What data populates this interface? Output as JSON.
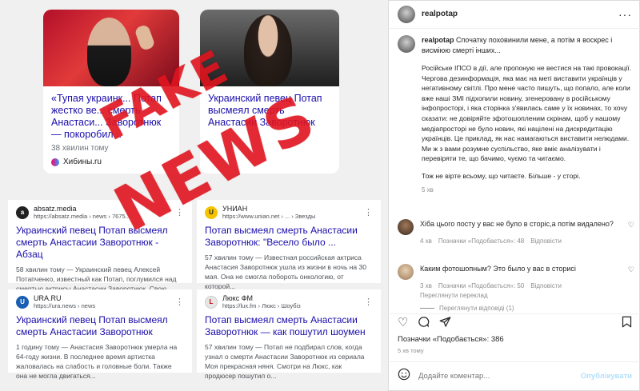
{
  "left": {
    "card1": {
      "title": "«Тупая украинк... Потап жестко ве... смерть Анастаси... Заворотнюк — покоробил...",
      "time": "38 хвилин тому",
      "source": "Хибины.ru"
    },
    "card2": {
      "title": "Украинский певец Потап высмеял смерть Анастасии Заворотнюк"
    },
    "fake_line1": "FAKE",
    "fake_line2": "NEWS",
    "results": [
      {
        "site": "absatz.media",
        "url": "https://absatz.media › news › 7675...",
        "title": "Украинский певец Потап высмеял смерть Анастасии Заворотнюк - Абзац",
        "snippet": "58 хвилин тому — Украинский певец Алексей Потапченко, известный как Потап, поглумился над смертью актрисы Анастасии Заворотнюк. Свою мерзкую «сториз» он ..."
      },
      {
        "site": "УНИАН",
        "url": "https://www.unian.net › ... › Звезды",
        "title": "Потап высмеял смерть Анастасии Заворотнюк: \"Весело было ...",
        "snippet": "57 хвилин тому — Известная российская актриса Анастасия Заворотнюк ушла из жизни в ночь на 30 мая. Она не смогла побороть онкологию, от которой..."
      },
      {
        "site": "URA.RU",
        "url": "https://ura.news › news",
        "title": "Украинский певец Потап высмеял смерть Анастасии Заворотнюк",
        "snippet": "1 годину тому — Анастасия Заворотнюк умерла на 64-году жизни. В последнее время артистка жаловалась на слабость и головные боли. Также она не могла двигаться..."
      },
      {
        "site": "Люкс ФМ",
        "url": "https://lux.fm › Люкс › Шоубіз",
        "title": "Потап высмеял смерть Анастасии Заворотнюк — как пошутил шоумен",
        "snippet": "57 хвилин тому — Потап не подбирал слов, когда узнал о смерти Анастасии Заворотнюк из сериала Моя прекрасная няня. Смотри на Люкс, как продюсер пошутил о..."
      }
    ]
  },
  "panel": {
    "username": "realpotap",
    "caption_user": "realpotap",
    "caption_first": "Спочатку поховинили мене, а потім я воскрес і висміюю смерті інших...",
    "paragraphs": [
      "Російське ІПСО в дії, але пропоную не вестися на такі провокації. Чергова дезинформація, яка має на меті виставити українців у негативному світлі. Про мене часто пишуть, що попало, але коли вже наші ЗМІ підхопили новину, згенеровану в російському інфопросторі, і яка сторінка з'явилась саме у їх новинах, то хочу сказати: не довіряйте зфотошопленим скрінам, щоб у нашому медіапросторі не було новин, які націлені на дискредитацію українців. Це приклад, як нас намагаються виставити нелюдами. Ми ж з вами розумне суспільство, яке вміє аналізувати і перевіряти те, що бачимо, чуємо та читаємо.",
      "Тож не вірте всьому, що читаєте. Більше - у сторі."
    ],
    "caption_time": "5 хв",
    "comments": [
      {
        "text": "Хіба цього посту у вас не було в сторіс,а потім видалено?",
        "time": "4 хв",
        "likes": "Позначки «Подобається»: 48",
        "reply": "Відповісти"
      },
      {
        "text": "Каким фотошопным? Это было у вас в сторисі",
        "time": "3 хв",
        "likes": "Позначки «Подобається»: 50",
        "reply": "Відповісти",
        "translate": "Переглянути переклад"
      }
    ],
    "view_replies": "Переглянути відповіді (1)",
    "likes_count": "Позначки «Подобається»: 386",
    "post_time": "5 хв тому",
    "comment_placeholder": "Додайте коментар...",
    "publish_label": "Опублікувати",
    "more_label": "···"
  }
}
